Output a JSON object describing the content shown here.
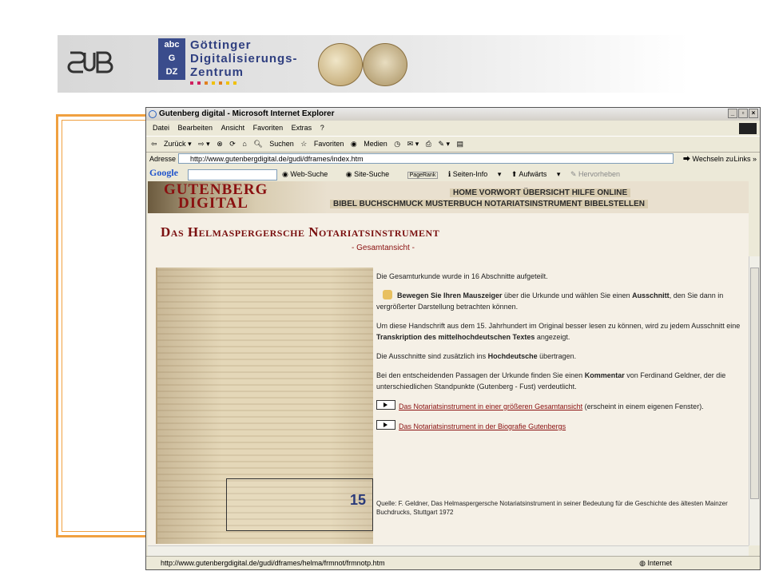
{
  "slide": {
    "gdz_abc": [
      "abc",
      "G",
      "DZ"
    ],
    "gdz_title": "Göttinger\nDigitalisierungs-\nZentrum",
    "gdz_dot_colors": [
      "#d02060",
      "#d02060",
      "#e08020",
      "#f0c000",
      "#e08020",
      "#f0c000",
      "#f0c000"
    ]
  },
  "browser": {
    "title": "Gutenberg digital - Microsoft Internet Explorer",
    "menu": [
      "Datei",
      "Bearbeiten",
      "Ansicht",
      "Favoriten",
      "Extras",
      "?"
    ],
    "toolbar": [
      "Zurück",
      "Suchen",
      "Favoriten",
      "Medien"
    ],
    "address_label": "Adresse",
    "address_url": "http://www.gutenbergdigital.de/gudi/dframes/index.htm",
    "go_label": "Wechseln zu",
    "links_label": "Links",
    "google_label": "Google",
    "google_items": [
      "Web-Suche",
      "Site-Suche",
      "PageRank",
      "Seiten-Info",
      "Aufwärts",
      "Hervorheben"
    ],
    "status_url": "http://www.gutenbergdigital.de/gudi/dframes/helma/frmnot/frmnotp.htm",
    "status_zone": "Internet"
  },
  "page": {
    "banner_title_1": "GUTENBERG",
    "banner_title_2": "DIGITAL",
    "nav_top": "HOME VORWORT ÜBERSICHT HILFE ONLINE",
    "nav_bottom": "BIBEL BUCHSCHMUCK MUSTERBUCH NOTARIATSINSTRUMENT BIBELSTELLEN",
    "title": "Das Helmaspergersche Notariatsinstrument",
    "subtitle": "- Gesamtansicht -",
    "selection_number": "15",
    "p1": "Die Gesamturkunde wurde in 16 Abschnitte aufgeteilt.",
    "p2_a": "Bewegen Sie Ihren Mauszeiger",
    "p2_b": " über die Urkunde und wählen Sie einen ",
    "p2_c": "Ausschnitt",
    "p2_d": ", den Sie dann in vergrößerter Darstellung betrachten können.",
    "p3_a": "Um diese Handschrift aus dem 15. Jahrhundert im Original besser lesen zu können, wird zu jedem Ausschnitt eine ",
    "p3_b": "Transkription des mittelhochdeutschen Textes",
    "p3_c": " angezeigt.",
    "p4_a": "Die Ausschnitte sind zusätzlich ins ",
    "p4_b": "Hochdeutsche",
    "p4_c": " übertragen.",
    "p5_a": "Bei den entscheidenden Passagen der Urkunde finden Sie einen ",
    "p5_b": "Kommentar",
    "p5_c": " von Ferdinand Geldner, der die unterschiedlichen Standpunkte (Gutenberg - Fust) verdeutlicht.",
    "link1": "Das Notariatsinstrument in einer größeren Gesamtansicht",
    "link1_after": " (erscheint in einem eigenen Fenster).",
    "link2": "Das Notariatsinstrument in der Biografie Gutenbergs",
    "source": "Quelle: F. Geldner, Das Helmaspergersche Notariatsinstrument in seiner Bedeutung für die Geschichte des ältesten Mainzer Buchdrucks, Stuttgart 1972"
  }
}
